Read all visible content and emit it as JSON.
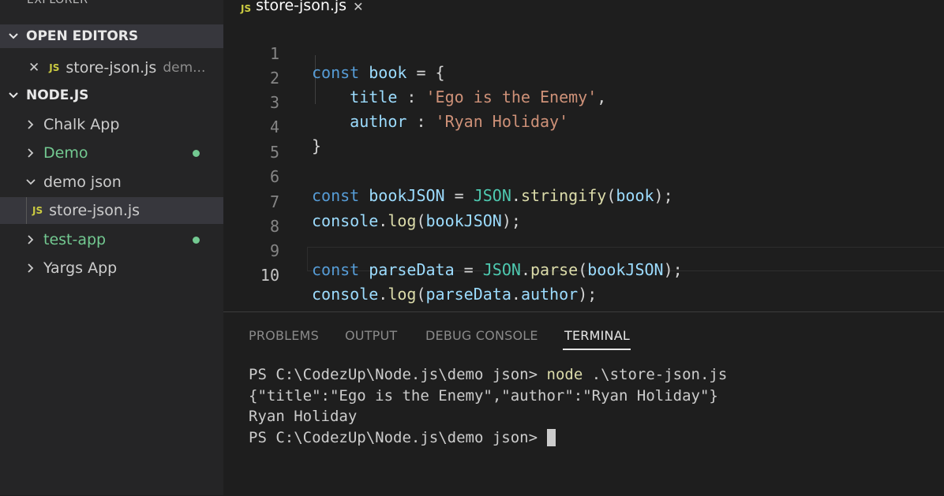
{
  "sidebar": {
    "title": "EXPLORER",
    "open_editors": {
      "header": "OPEN EDITORS",
      "item": {
        "close": "✕",
        "badge": "JS",
        "name": "store-json.js",
        "folder": "dem..."
      }
    },
    "project": {
      "header": "NODE.JS",
      "items": [
        {
          "label": "Chalk App"
        },
        {
          "label": "Demo"
        },
        {
          "label": "demo json"
        },
        {
          "badge": "JS",
          "label": "store-json.js"
        },
        {
          "label": "test-app"
        },
        {
          "label": "Yargs App"
        }
      ]
    }
  },
  "tab": {
    "badge": "JS",
    "label": "store-json.js",
    "close": "✕"
  },
  "editor": {
    "line_numbers": [
      "1",
      "2",
      "3",
      "4",
      "5",
      "6",
      "7",
      "8",
      "9",
      "10"
    ],
    "current_line": 10
  },
  "panel": {
    "tabs": [
      "PROBLEMS",
      "OUTPUT",
      "DEBUG CONSOLE",
      "TERMINAL"
    ],
    "active_tab": "TERMINAL",
    "terminal": {
      "prompt1": "PS C:\\CodezUp\\Node.js\\demo json> ",
      "command": "node",
      "args": " .\\store-json.js",
      "output1": "{\"title\":\"Ego is the Enemy\",\"author\":\"Ryan Holiday\"}",
      "output2": "Ryan Holiday",
      "prompt2": "PS C:\\CodezUp\\Node.js\\demo json> "
    }
  },
  "colors": {
    "background": "#1e1e1e",
    "sidebar": "#252526",
    "keyword": "#569cd6",
    "variable": "#9cdcfe",
    "string": "#ce9178",
    "function": "#dcdcaa",
    "class": "#4ec9b0",
    "git_untracked": "#73c991",
    "js_badge": "#cbcb41"
  }
}
